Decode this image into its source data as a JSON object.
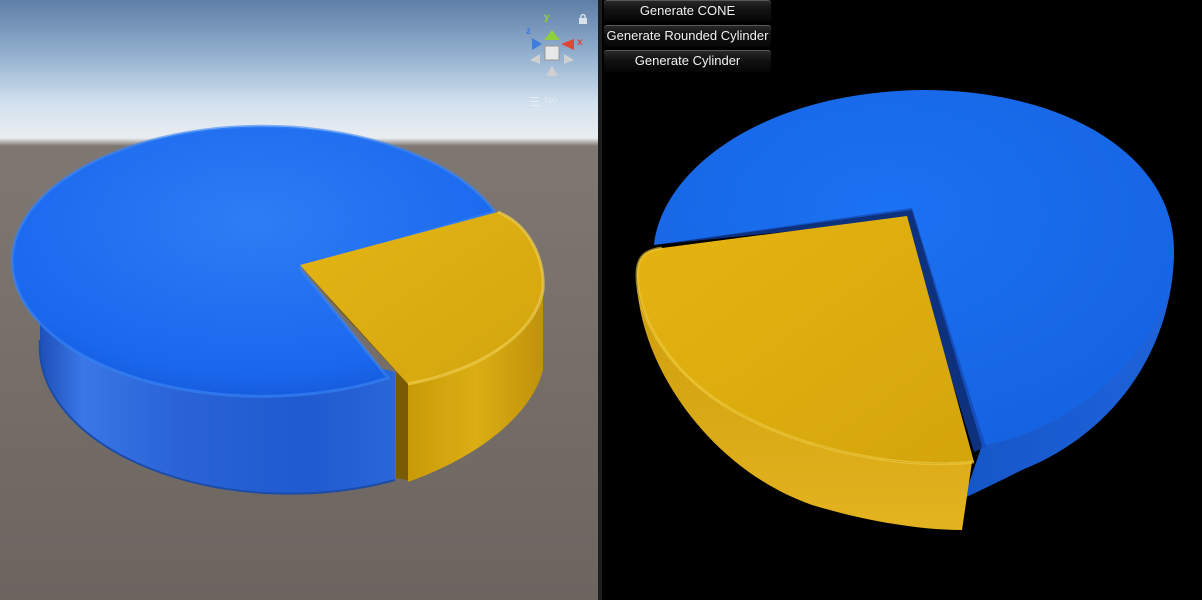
{
  "scene_view": {
    "gizmo": {
      "axis_x": "x",
      "axis_y": "y",
      "axis_z": "z"
    },
    "view_mode": "Iso",
    "icons": [
      "scene-gizmo-icon",
      "lock-icon",
      "menu-icon"
    ],
    "colors": {
      "axis_x": "#e0443a",
      "axis_y": "#8fd13d",
      "axis_z": "#3d7de0"
    }
  },
  "game_view": {
    "buttons": {
      "cone": "Generate CONE",
      "rounded_cylinder": "Generate Rounded Cylinder",
      "cylinder": "Generate Cylinder"
    }
  },
  "pie": {
    "colors": {
      "blue": "#1a6ef0",
      "yellow": "#e0b010"
    }
  }
}
